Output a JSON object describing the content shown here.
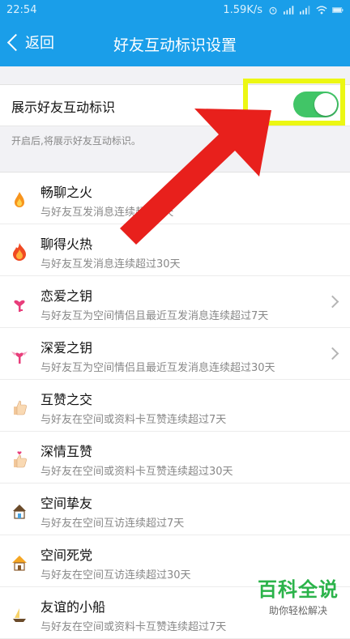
{
  "status_bar": {
    "time": "22:54",
    "network_speed": "1.59K/s",
    "battery_color": "#ffffff"
  },
  "nav": {
    "back_label": "返回",
    "title": "好友互动标识设置"
  },
  "toggle": {
    "label": "展示好友互动标识",
    "state": "on",
    "on_color": "#41c567",
    "highlight_color": "#ecf713"
  },
  "hint": "开启后,将展示好友互动标识。",
  "items": [
    {
      "title": "畅聊之火",
      "desc": "与好友互发消息连续超过7天",
      "icon": "flame-icon",
      "has_arrow": false
    },
    {
      "title": "聊得火热",
      "desc": "与好友互发消息连续超过30天",
      "icon": "big-flame-icon",
      "has_arrow": false
    },
    {
      "title": "恋爱之钥",
      "desc": "与好友互为空间情侣且最近互发消息连续超过7天",
      "icon": "pink-key-icon",
      "has_arrow": true
    },
    {
      "title": "深爱之钥",
      "desc": "与好友互为空间情侣且最近互发消息连续超过30天",
      "icon": "winged-key-icon",
      "has_arrow": true
    },
    {
      "title": "互赞之交",
      "desc": "与好友在空间或资料卡互赞连续超过7天",
      "icon": "thumbs-up-icon",
      "has_arrow": false
    },
    {
      "title": "深情互赞",
      "desc": "与好友在空间或资料卡互赞连续超过30天",
      "icon": "thumbs-up-heart-icon",
      "has_arrow": false
    },
    {
      "title": "空间挚友",
      "desc": "与好友在空间互访连续超过7天",
      "icon": "house-icon",
      "has_arrow": false
    },
    {
      "title": "空间死党",
      "desc": "与好友在空间互访连续超过30天",
      "icon": "house-roof-icon",
      "has_arrow": false
    },
    {
      "title": "友谊的小船",
      "desc": "与好友在空间或资料卡互赞连续超过7天",
      "icon": "boat-icon",
      "has_arrow": false
    }
  ],
  "watermark": {
    "big": "百科全说",
    "small": "助你轻松解决"
  },
  "colors": {
    "accent": "#1a9ee9",
    "arrow": "#e8201c"
  }
}
